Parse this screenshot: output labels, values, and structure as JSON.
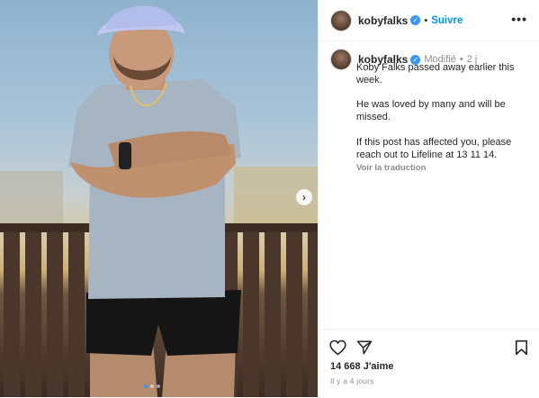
{
  "post": {
    "username": "kobyfalks",
    "follow_label": "Suivre",
    "separator": "•",
    "more_label": "•••",
    "caption": {
      "username": "kobyfalks",
      "edited": "Modifié",
      "age": "2 j",
      "lines": [
        "Koby Falks passed away earlier this week.",
        "He was loved by many and will be missed.",
        "If this post has affected you, please reach out to Lifeline at 13 11 14."
      ],
      "translate_label": "Voir la traduction"
    },
    "likes": "14 668 J'aime",
    "posted": "Il y a 4 jours"
  },
  "media": {
    "next_arrow": "›",
    "carousel_count": 3
  },
  "icons": {
    "heart": "heart-icon",
    "share": "paper-plane-icon",
    "save": "bookmark-icon",
    "verified": "verified-badge-icon",
    "more": "more-options-icon"
  },
  "colors": {
    "link_blue": "#0095f6",
    "verified_blue": "#3897f0",
    "muted": "#8e8e8e",
    "text": "#262626"
  }
}
